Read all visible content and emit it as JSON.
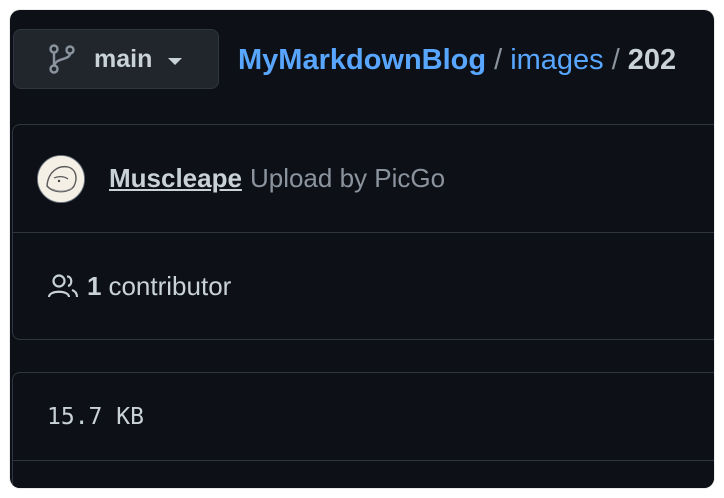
{
  "branch": {
    "icon": "git-branch-icon",
    "name": "main"
  },
  "breadcrumb": {
    "repo": "MyMarkdownBlog",
    "folder": "images",
    "current": "202",
    "separator": "/"
  },
  "commit": {
    "author": "Muscleape",
    "message": "Upload by PicGo"
  },
  "contributors": {
    "icon": "people-icon",
    "count": "1",
    "label": "contributor"
  },
  "file": {
    "size": "15.7 KB"
  },
  "colors": {
    "background": "#0d1117",
    "link": "#58a6ff",
    "text": "#c9d1d9",
    "muted": "#8b949e",
    "border": "#30363d"
  }
}
